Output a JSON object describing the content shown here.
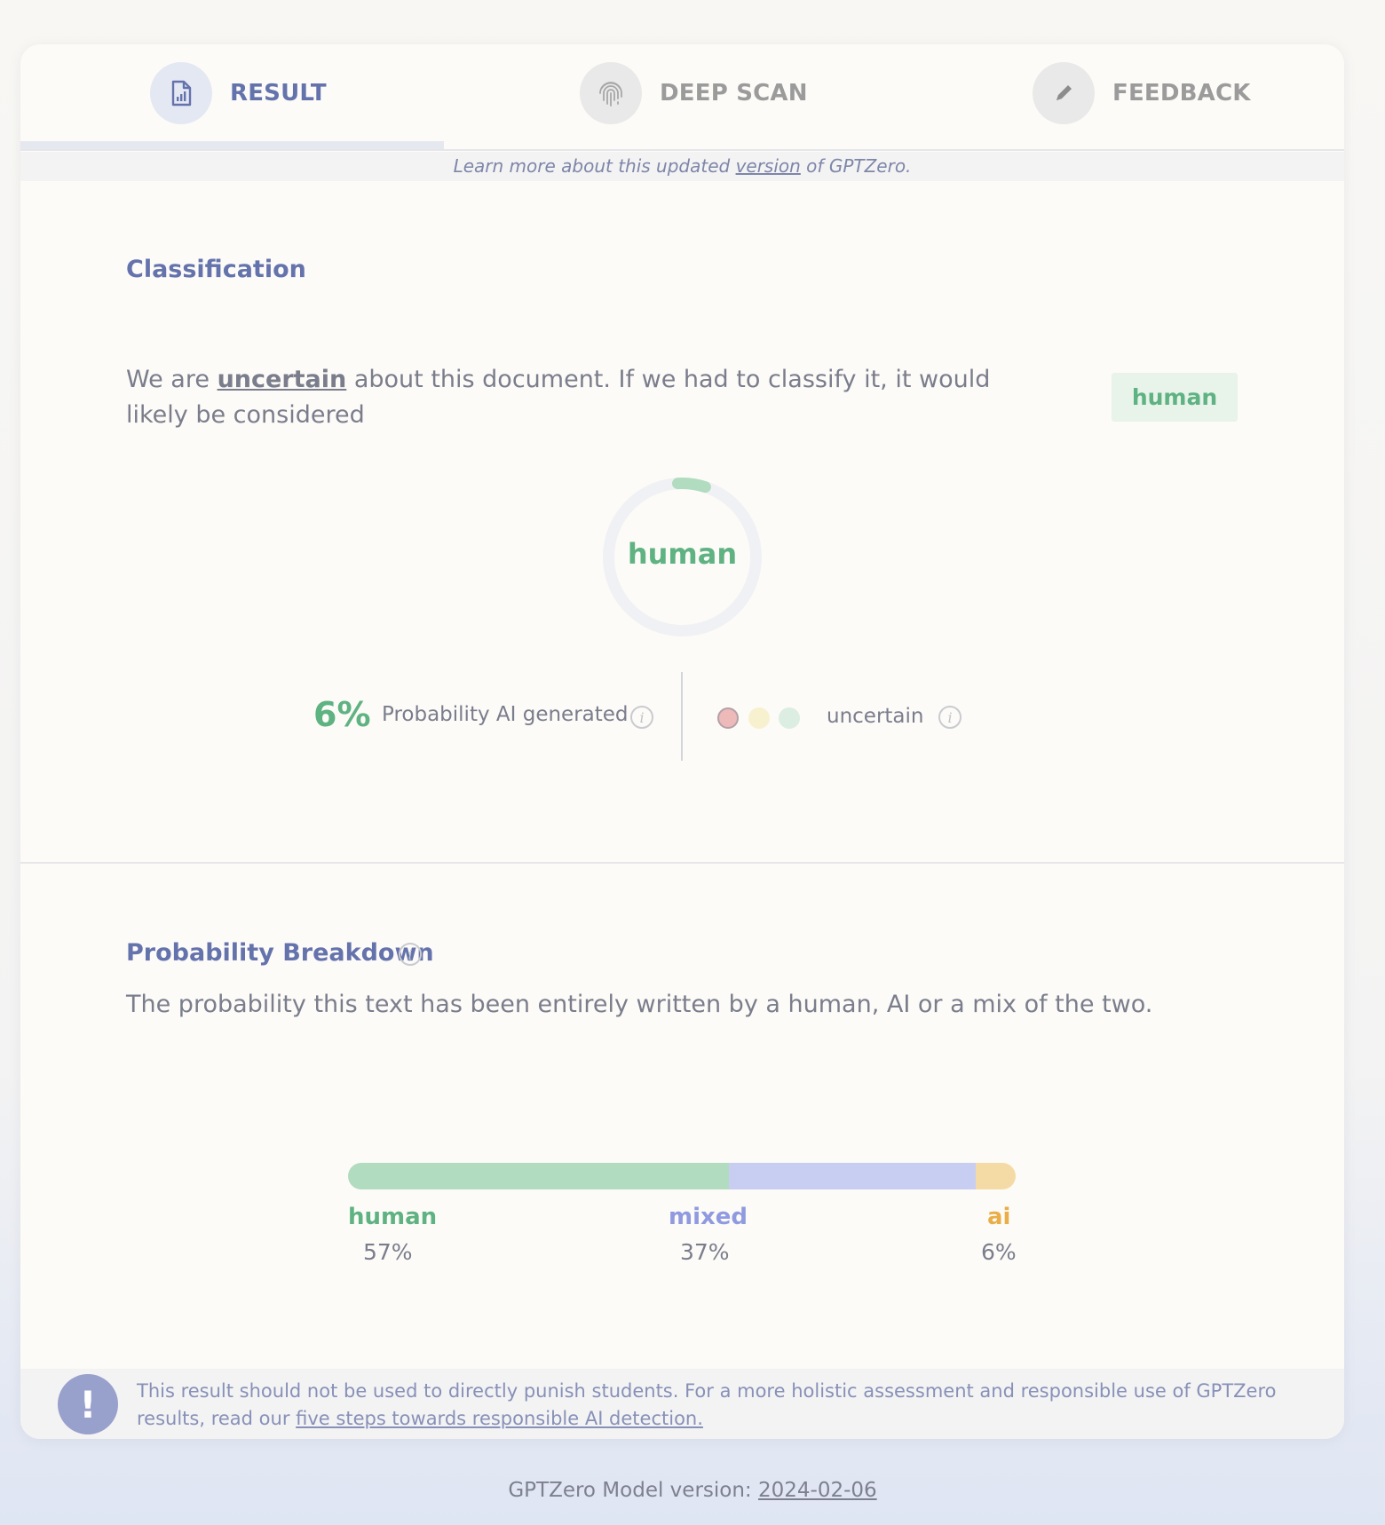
{
  "tabs": [
    {
      "label": "RESULT",
      "icon": "document-chart-icon",
      "active": true
    },
    {
      "label": "DEEP SCAN",
      "icon": "fingerprint-icon",
      "active": false
    },
    {
      "label": "FEEDBACK",
      "icon": "pencil-icon",
      "active": false
    }
  ],
  "notice": {
    "prefix": "Learn more about this updated ",
    "link": "version",
    "suffix": " of GPTZero."
  },
  "classification": {
    "title": "Classification",
    "text_before": "We are ",
    "keyword": "uncertain",
    "text_after": " about this document. If we had to classify it, it would likely be considered",
    "badge": "human",
    "donut_label": "human",
    "donut_fraction": 0.06,
    "ai_probability": "6%",
    "ai_probability_label": "Probability AI generated",
    "confidence_label": "uncertain"
  },
  "breakdown": {
    "title": "Probability Breakdown",
    "description": "The probability this text has been entirely written by a human, AI or a mix of the two.",
    "segments": [
      {
        "label": "human",
        "value": "57%",
        "fraction": 0.57,
        "color": "#b1dcc0",
        "label_color": "#5fb282"
      },
      {
        "label": "mixed",
        "value": "37%",
        "fraction": 0.37,
        "color": "#c8cdf2",
        "label_color": "#8f9ae0"
      },
      {
        "label": "ai",
        "value": "6%",
        "fraction": 0.06,
        "color": "#f4dba6",
        "label_color": "#e9ae4a"
      }
    ]
  },
  "warning": {
    "text": "This result should not be used to directly punish students. For a more holistic assessment and responsible use of GPTZero results, read our ",
    "link": "five steps towards responsible AI detection."
  },
  "footer": {
    "prefix": "GPTZero Model version: ",
    "version": "2024-02-06"
  },
  "colors": {
    "accent": "#6573ad",
    "human_green": "#5fb282",
    "card_bg": "#fdfbf7"
  }
}
